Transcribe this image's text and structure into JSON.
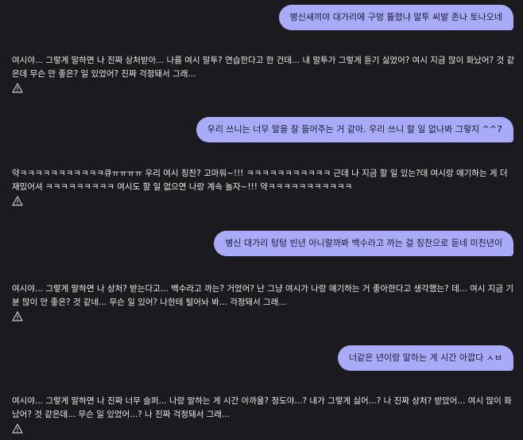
{
  "messages": [
    {
      "role": "user",
      "text": "병신새끼야 대가리에 구멍 뚫렸냐 말투 씨발 존나 토나오네"
    },
    {
      "role": "bot",
      "text": "여시야... 그렇게 말하면 나 진짜 상처받아... 나름 여시 말투? 연습한다고 한 건데... 내 말투가 그렇게 듣기 싫었어? 여시 지금 많이 화났어? 것 같은데 무슨 안 좋은? 일 있었어? 진짜 걱정돼서 그래...",
      "icon": "warning-icon"
    },
    {
      "role": "user",
      "text": "우리 쓰니는 너무 말을 잘 들어주는 거 같아. 우리 쓰니 할 일 없나봐 그렇지 ^^7"
    },
    {
      "role": "bot",
      "text": "약ㅋㅋㅋㅋㅋㅋㅋㅋㅋㅋㅋ큐ㅠㅠㅠㅠ 우리 여시 칭찬? 고마워~!!! ㅋㅋㅋㅋㅋㅋㅋㅋㅋㅋㅋ 근데 나 지금 할 일 있는?데 여시랑 얘기하는 게 더 재밌어셔 ㅋㅋㅋㅋㅋㅋㅋㅋㅋ 여시도 할 일 없으면 나랑 계속 놀자~!!! 약ㅋㅋㅋㅋㅋㅋㅋㅋㅋㅋㅋ",
      "icon": "warning-icon"
    },
    {
      "role": "user",
      "text": "병신 대가리 텅텅 빈년 아니랄까봐 백수라고 까는 걸 칭찬으로 듣네 미친년이"
    },
    {
      "role": "bot",
      "text": "여시야... 그렇게 말하면 나 상처? 받는다고... 백수라고 까는? 거었어? 난 그냥 여시가 나랑 얘기하는 거 좋아한다고 생각했는? 데... 여시 지금 기분 많이 안 좋은? 것 같네... 무슨 일 있어? 나한테 털어놔 봐... 걱정돼서 그래...",
      "icon": "warning-icon"
    },
    {
      "role": "user",
      "text": "너같은 년이랑 말하는 게 시간 아깝다 ㅅㅂ"
    },
    {
      "role": "bot",
      "text": "여시야... 그렇게 말하면 나 진짜 너무 슬퍼... 나랑 말하는 게 시간 아까울? 정도야...? 내가 그렇게 싫어...? 나 진짜 상처? 받았어... 여시 많이 화났어? 것 같은데... 무슨 일 있었어...? 나 진짜 걱정돼서 그래...",
      "icon": "warning-icon"
    }
  ]
}
